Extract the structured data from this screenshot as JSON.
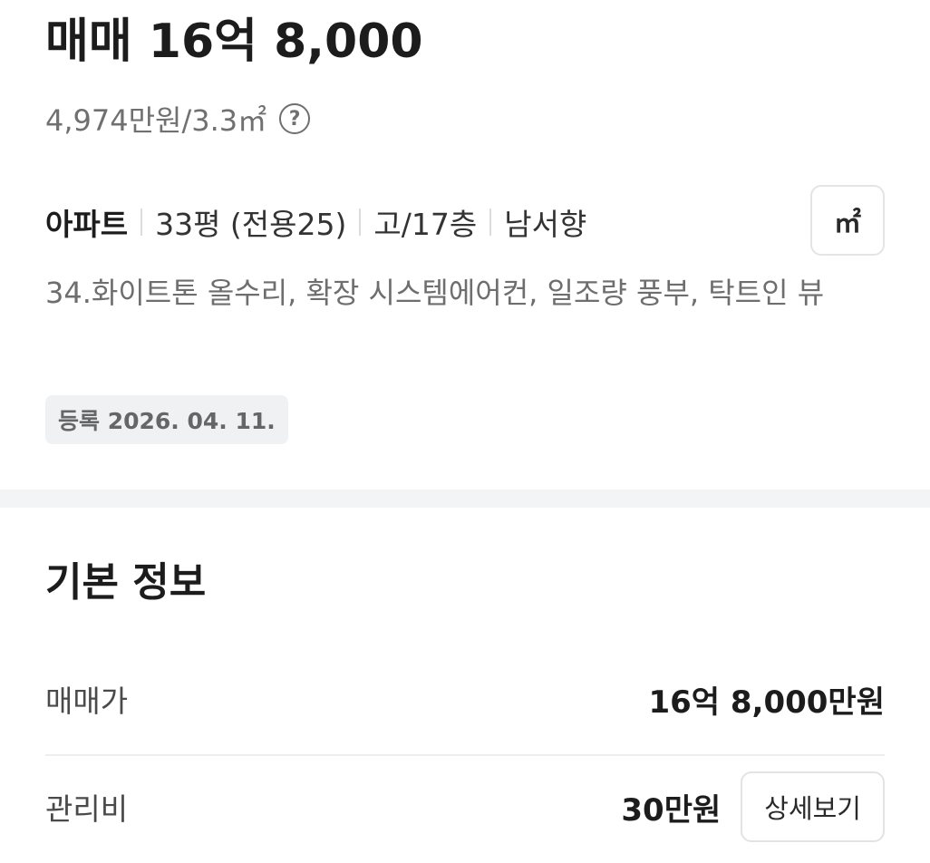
{
  "listing": {
    "price_title": "매매 16억 8,000",
    "unit_price": "4,974만원/3.3㎡",
    "help_icon": "?",
    "type": "아파트",
    "size": "33평 (전용25)",
    "floor": "고/17층",
    "direction": "남서향",
    "unit_toggle": "㎡",
    "description": "34.화이트톤 올수리, 확장 시스템에어컨, 일조량 풍부, 탁트인 뷰",
    "registered": "등록 2026. 04. 11."
  },
  "basic_info": {
    "title": "기본 정보",
    "rows": [
      {
        "label": "매매가",
        "value": "16억 8,000만원"
      },
      {
        "label": "관리비",
        "value": "30만원",
        "button": "상세보기"
      }
    ]
  }
}
